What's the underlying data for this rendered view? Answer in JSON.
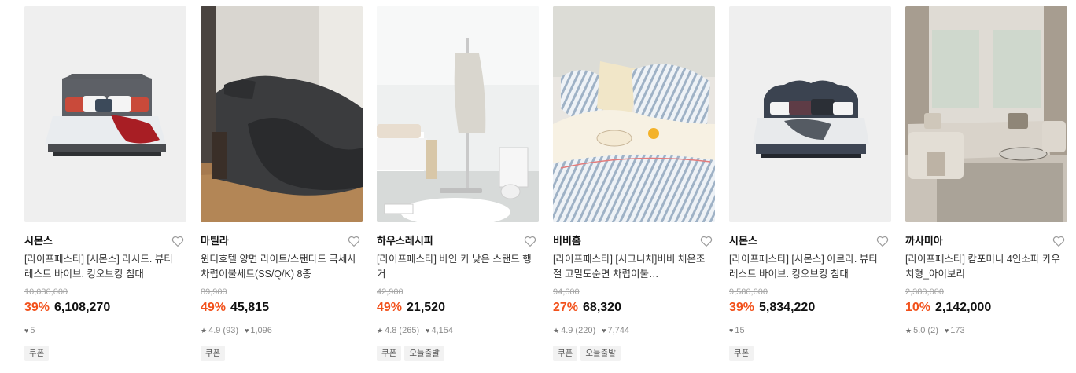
{
  "products": [
    {
      "brand": "시몬스",
      "title": "[라이프페스타] [시몬스] 라시드. 뷰티레스트 바이브. 킹오브킹 침대",
      "original_price": "10,030,000",
      "discount": "39%",
      "price": "6,108,270",
      "likes": "5",
      "tags": [
        "쿠폰"
      ]
    },
    {
      "brand": "마틸라",
      "title": "윈터호텔 양면 라이트/스탠다드 극세사 차렵이불세트(SS/Q/K) 8종",
      "original_price": "89,900",
      "discount": "49%",
      "price": "45,815",
      "rating": "4.9 (93)",
      "likes": "1,096",
      "tags": [
        "쿠폰"
      ]
    },
    {
      "brand": "하우스레시피",
      "title": "[라이프페스타] 바인 키 낮은 스탠드 행거",
      "original_price": "42,900",
      "discount": "49%",
      "price": "21,520",
      "rating": "4.8 (265)",
      "likes": "4,154",
      "tags": [
        "쿠폰",
        "오늘출발"
      ]
    },
    {
      "brand": "비비홈",
      "title": "[라이프페스타] [시그니처]비비 체온조절 고밀도순면 차렵이불…",
      "original_price": "94,600",
      "discount": "27%",
      "price": "68,320",
      "rating": "4.9 (220)",
      "likes": "7,744",
      "tags": [
        "쿠폰",
        "오늘출발"
      ]
    },
    {
      "brand": "시몬스",
      "title": "[라이프페스타] [시몬스] 아르라. 뷰티레스트 바이브. 킹오브킹 침대",
      "original_price": "9,580,000",
      "discount": "39%",
      "price": "5,834,220",
      "likes": "15",
      "tags": [
        "쿠폰"
      ]
    },
    {
      "brand": "까사미아",
      "title": "[라이프페스타] 캄포미니 4인소파 카우치형_아이보리",
      "original_price": "2,380,000",
      "discount": "10%",
      "price": "2,142,000",
      "rating": "5.0 (2)",
      "likes": "173",
      "tags": []
    }
  ],
  "icons": {
    "heart_outline": "heart-outline-icon",
    "star": "star-icon",
    "heart_filled": "heart-filled-icon"
  },
  "colors": {
    "discount": "#f2511b",
    "strike": "#a6a6a6",
    "tag_bg": "#f2f2f2"
  }
}
